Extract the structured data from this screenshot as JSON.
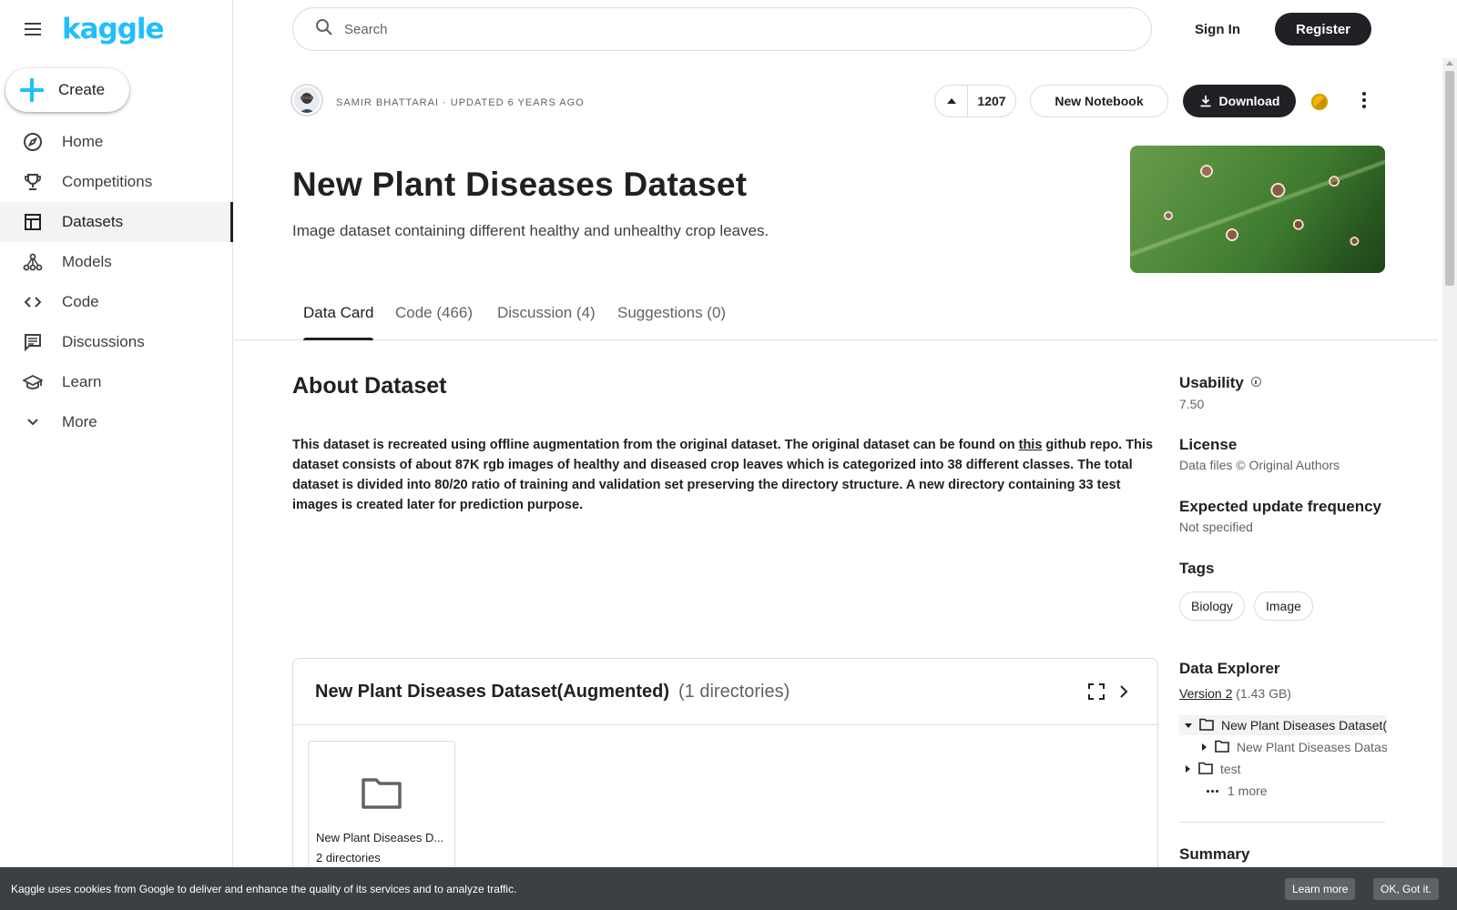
{
  "brand": {
    "logo_text": "kaggle",
    "accent": "#20beff"
  },
  "sidebar": {
    "create_label": "Create",
    "items": [
      {
        "label": "Home",
        "icon": "compass-icon"
      },
      {
        "label": "Competitions",
        "icon": "trophy-icon"
      },
      {
        "label": "Datasets",
        "icon": "table-icon",
        "active": true
      },
      {
        "label": "Models",
        "icon": "models-icon"
      },
      {
        "label": "Code",
        "icon": "code-icon"
      },
      {
        "label": "Discussions",
        "icon": "comments-icon"
      },
      {
        "label": "Learn",
        "icon": "school-icon"
      },
      {
        "label": "More",
        "icon": "chevron-down-icon"
      }
    ]
  },
  "header": {
    "search_placeholder": "Search",
    "sign_in_label": "Sign In",
    "register_label": "Register"
  },
  "dataset": {
    "author_meta": "Samir Bhattarai · Updated 6 years ago",
    "upvotes": "1207",
    "new_notebook_label": "New Notebook",
    "download_label": "Download",
    "title": "New Plant Diseases Dataset",
    "subtitle": "Image dataset containing different healthy and unhealthy crop leaves."
  },
  "tabs": [
    {
      "label": "Data Card",
      "active": true
    },
    {
      "label": "Code (466)"
    },
    {
      "label": "Discussion (4)"
    },
    {
      "label": "Suggestions (0)"
    }
  ],
  "about": {
    "heading": "About Dataset",
    "text_before_link": "This dataset is recreated using offline augmentation from the original dataset. The original dataset can be found on ",
    "link_text": "this",
    "text_after_link": " github repo. This dataset consists of about 87K rgb images of healthy and diseased crop leaves which is categorized into 38 different classes. The total dataset is divided into 80/20 ratio of training and validation set preserving the directory structure. A new directory containing 33 test images is created later for prediction purpose."
  },
  "explorer_panel": {
    "title": "New Plant Diseases Dataset(Augmented)",
    "count": "(1 directories)",
    "folder_name": "New Plant Diseases D...",
    "folder_sub": "2 directories"
  },
  "side": {
    "usability_label": "Usability",
    "usability_value": "7.50",
    "license_label": "License",
    "license_value": "Data files © Original Authors",
    "frequency_label": "Expected update frequency",
    "frequency_value": "Not specified",
    "tags_label": "Tags",
    "tags": [
      "Biology",
      "Image"
    ],
    "explorer_label": "Data Explorer",
    "version_link": "Version 2",
    "version_size": "(1.43 GB)",
    "tree": [
      "New Plant Diseases Dataset(Augmented)",
      "New Plant Diseases Dataset(Augmented)",
      "test",
      "1 more"
    ],
    "summary_label": "Summary"
  },
  "cookie": {
    "text": "Kaggle uses cookies from Google to deliver and enhance the quality of its services and to analyze traffic.",
    "learn_more": "Learn more",
    "ok": "OK, Got it."
  }
}
